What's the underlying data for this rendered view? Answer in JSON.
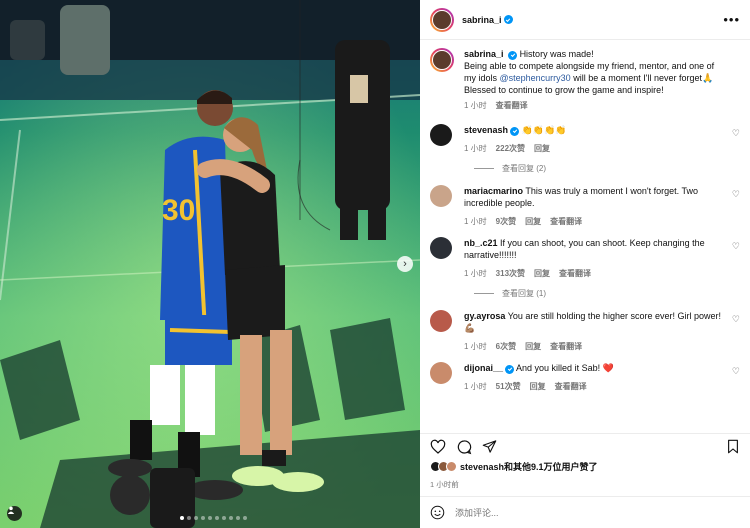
{
  "post": {
    "author": "sabrina_i",
    "more_icon": "ellipsis-icon",
    "caption": {
      "username": "sabrina_i",
      "text_1": "History was made!",
      "text_2": "Being able to compete alongside my friend, mentor, and one of",
      "text_3a": "my idols ",
      "mention": "@stephencurry30",
      "text_3b": " will be a moment I'll never forget🙏",
      "text_4": "Blessed to continue to grow the game and inspire!",
      "time": "1 小时",
      "translate": "查看翻译"
    },
    "comments": [
      {
        "username": "stevenash",
        "verified": true,
        "text": "👏👏👏👏",
        "time": "1 小时",
        "likes": "222次赞",
        "reply": "回复",
        "translate": "",
        "avatar_color": "#1a1a1a",
        "view_replies": "查看回复 (2)"
      },
      {
        "username": "mariacmarino",
        "verified": false,
        "text": "This was truly a moment I won't forget. Two incredible people.",
        "time": "1 小时",
        "likes": "9次赞",
        "reply": "回复",
        "translate": "查看翻译",
        "avatar_color": "#c9a48a",
        "view_replies": ""
      },
      {
        "username": "nb_.c21",
        "verified": false,
        "text": "If you can shoot, you can shoot. Keep changing the narrative!!!!!!!",
        "time": "1 小时",
        "likes": "313次赞",
        "reply": "回复",
        "translate": "查看翻译",
        "avatar_color": "#2b2f36",
        "view_replies": "查看回复 (1)"
      },
      {
        "username": "gy.ayrosa",
        "verified": false,
        "text": "You are still holding the higher score ever! Girl power! 💪🏽",
        "time": "1 小时",
        "likes": "6次赞",
        "reply": "回复",
        "translate": "查看翻译",
        "avatar_color": "#b85a4a",
        "view_replies": ""
      },
      {
        "username": "dijonai__",
        "verified": true,
        "text": "And you killed it Sab! ❤️",
        "time": "1 小时",
        "likes": "51次赞",
        "reply": "回复",
        "translate": "查看翻译",
        "avatar_color": "#c98b6b",
        "view_replies": ""
      }
    ],
    "liked_by": "stevenash和其他9.1万位用户赞了",
    "time": "1 小时前",
    "add_comment_placeholder": "添加评论...",
    "photo_jersey_number": "30",
    "carousel": {
      "total": 10,
      "active": 0
    }
  },
  "colors": {
    "court": "#1f8f6e",
    "court_light": "#7fd07a",
    "warriors_blue": "#1d57c0",
    "warriors_gold": "#f2c230",
    "accent": "#0095f6"
  }
}
